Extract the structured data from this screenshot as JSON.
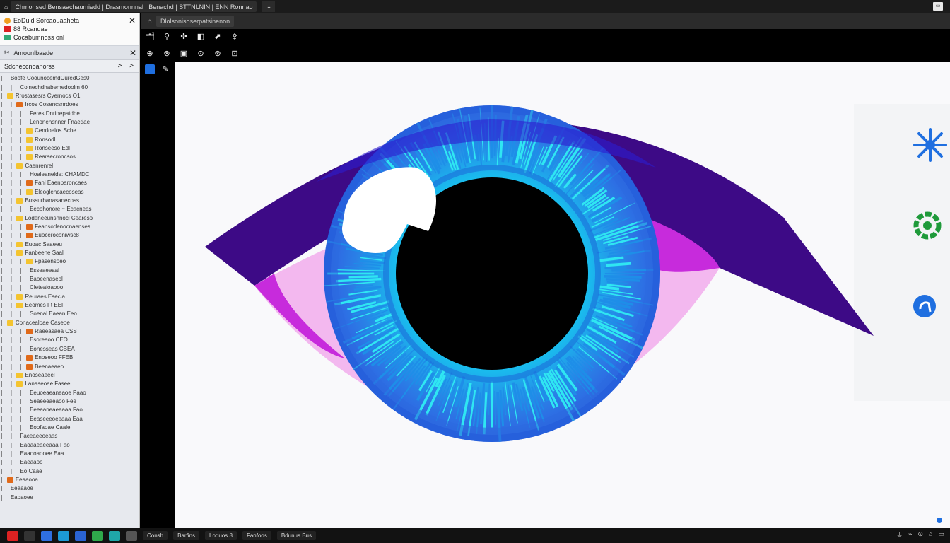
{
  "title_bar": {
    "tab_title": "Chmonsed Bensaachaumiedd | Drasmonnnal | Benachd | STTNLNIN | ENN Ronnao",
    "caret": "⌄",
    "window_button": "▭"
  },
  "toolbar": {
    "tab_label": "Dlolsonisoserpatsinenon"
  },
  "sidebar": {
    "header": {
      "line1": "EoDuld Sorcaouaaheta",
      "line2": "88 Rcandae",
      "line3": "Cocabumnoss onl",
      "close": "✕"
    },
    "filter_bar": {
      "label": "Amoonlbaade",
      "close": "✕"
    },
    "path_bar": {
      "label": "Sdcheccnoanorss",
      "arrows": "> >"
    },
    "tree": [
      {
        "guides": "| ",
        "folder": "",
        "label": "Boofe CoounocemdCuredGes0"
      },
      {
        "guides": "| |",
        "folder": "",
        "label": "Colnechdhabemedoolm 60"
      },
      {
        "guides": "| ",
        "folder": "#f4c430",
        "label": "Rrostasesrs Cyernocs O1"
      },
      {
        "guides": "| |",
        "folder": "#e06a1a",
        "label": "Ircos Cosencsnrdoes"
      },
      {
        "guides": "| | |",
        "folder": "",
        "label": "Feres Dnrinepatdbe"
      },
      {
        "guides": "| | |",
        "folder": "",
        "label": "Lenonensnner Fnaedae"
      },
      {
        "guides": "| | |",
        "folder": "#f4c430",
        "label": "Cendoelos Sche"
      },
      {
        "guides": "| | |",
        "folder": "#f4c430",
        "label": "Ronsodl"
      },
      {
        "guides": "| | |",
        "folder": "#f4c430",
        "label": "Ronseeso Edl"
      },
      {
        "guides": "| | |",
        "folder": "#f4c430",
        "label": "Rearsecroncsos"
      },
      {
        "guides": "| |",
        "folder": "#f4c430",
        "label": "Caenrenrel"
      },
      {
        "guides": "| | |",
        "folder": "",
        "label": "Hoaleanelde: CHAMDC"
      },
      {
        "guides": "| | |",
        "folder": "#e06a1a",
        "label": "Fanl Eaenbaroncaes"
      },
      {
        "guides": "| | |",
        "folder": "#f4c430",
        "label": "Eleoglencaecoseas"
      },
      {
        "guides": "| |",
        "folder": "#f4c430",
        "label": "Bussurbanasanecoss"
      },
      {
        "guides": "| | |",
        "folder": "",
        "label": "Eecohonore ~ Ecacneas"
      },
      {
        "guides": "| |",
        "folder": "#f4c430",
        "label": "Lodeneeunsnnocl Ceareso"
      },
      {
        "guides": "| | |",
        "folder": "#e06a1a",
        "label": "Feansodenocnaenses"
      },
      {
        "guides": "| | |",
        "folder": "#e06a1a",
        "label": "Euoceroconiwsc8"
      },
      {
        "guides": "| |",
        "folder": "#f4c430",
        "label": "Euoac Saaeeu"
      },
      {
        "guides": "| |",
        "folder": "#f4c430",
        "label": "Fanbeene Saal"
      },
      {
        "guides": "| | |",
        "folder": "#f4c430",
        "label": "Fpasensoeo"
      },
      {
        "guides": "| | |",
        "folder": "",
        "label": "Esseaeeaal"
      },
      {
        "guides": "| | |",
        "folder": "",
        "label": "Baoeenaseol"
      },
      {
        "guides": "| | |",
        "folder": "",
        "label": "Cleteaioaooo"
      },
      {
        "guides": "| |",
        "folder": "#f4c430",
        "label": "Reuraes Esecia"
      },
      {
        "guides": "| |",
        "folder": "#f4c430",
        "label": "Eeomes Ft EEF"
      },
      {
        "guides": "| | |",
        "folder": "",
        "label": "Soenal Eaean Eeo"
      },
      {
        "guides": "| ",
        "folder": "#f4c430",
        "label": "Conacealoae Caseoe"
      },
      {
        "guides": "| | |",
        "folder": "#e06a1a",
        "label": "Raeeasaea CSS"
      },
      {
        "guides": "| | |",
        "folder": "",
        "label": "Esoreaoo CEO"
      },
      {
        "guides": "| | |",
        "folder": "",
        "label": "Eonesseas CBEA"
      },
      {
        "guides": "| | |",
        "folder": "#e06a1a",
        "label": "Enoseoo FFEB"
      },
      {
        "guides": "| | |",
        "folder": "#e06a1a",
        "label": "Beenaeaeo"
      },
      {
        "guides": "| |",
        "folder": "#f4c430",
        "label": "Enoseaeeel"
      },
      {
        "guides": "| |",
        "folder": "#f4c430",
        "label": "Lanaseoae Fasee"
      },
      {
        "guides": "| | |",
        "folder": "",
        "label": "Eeuoeaeaneaoe Paao"
      },
      {
        "guides": "| | |",
        "folder": "",
        "label": "Seaeeeaeaoo Fee"
      },
      {
        "guides": "| | |",
        "folder": "",
        "label": "Eeeaaneaeeaaa Fao"
      },
      {
        "guides": "| | |",
        "folder": "",
        "label": "Eeaseeeoeeaaa Eaa"
      },
      {
        "guides": "| | |",
        "folder": "",
        "label": "Eoofaoae Caale"
      },
      {
        "guides": "| |",
        "folder": "",
        "label": "Faceaeeoeaas"
      },
      {
        "guides": "| |",
        "folder": "",
        "label": "Eaoaaeaeeaaa Fao"
      },
      {
        "guides": "| |",
        "folder": "",
        "label": "Eaaooaooee Eaa"
      },
      {
        "guides": "| |",
        "folder": "",
        "label": "Eaeaaoo"
      },
      {
        "guides": "| |",
        "folder": "",
        "label": "Eo Caae"
      },
      {
        "guides": "| ",
        "folder": "#e06a1a",
        "label": "Eeaaooa"
      },
      {
        "guides": "| ",
        "folder": "",
        "label": "Eeaaaoe"
      },
      {
        "guides": "| ",
        "folder": "",
        "label": "Eaoaoee"
      }
    ]
  },
  "iconstrip": {
    "row1": [
      "🗂",
      "⚲",
      "✣",
      "◧",
      "⬈",
      "⚴"
    ],
    "row2": [
      "⊕",
      "⊗",
      "▣",
      "⊙",
      "⊛",
      "⊡"
    ]
  },
  "right_icons": [
    {
      "name": "sparkle-icon",
      "color": "#1f6fe0"
    },
    {
      "name": "gear-icon",
      "color": "#1e9a3a"
    },
    {
      "name": "refresh-icon",
      "color": "#1f6fe0"
    }
  ],
  "canvas": {
    "colors": {
      "lid_dark": "#3d0a86",
      "lid_mid": "#5b12a8",
      "sclera": "#f3b8ef",
      "magenta": "#c72bdc",
      "iris_outer": "#1f6fe0",
      "iris_inner": "#17d8ee",
      "pupil": "#000000",
      "highlight": "#ffffff"
    }
  },
  "taskbar": {
    "labels": [
      "Consh",
      "Barfins",
      "Loduos  8",
      "Fanfoos",
      "Bdunus Bus"
    ],
    "tray": [
      "⏚",
      "⌁",
      "⊙",
      "⌂",
      "▭"
    ]
  }
}
